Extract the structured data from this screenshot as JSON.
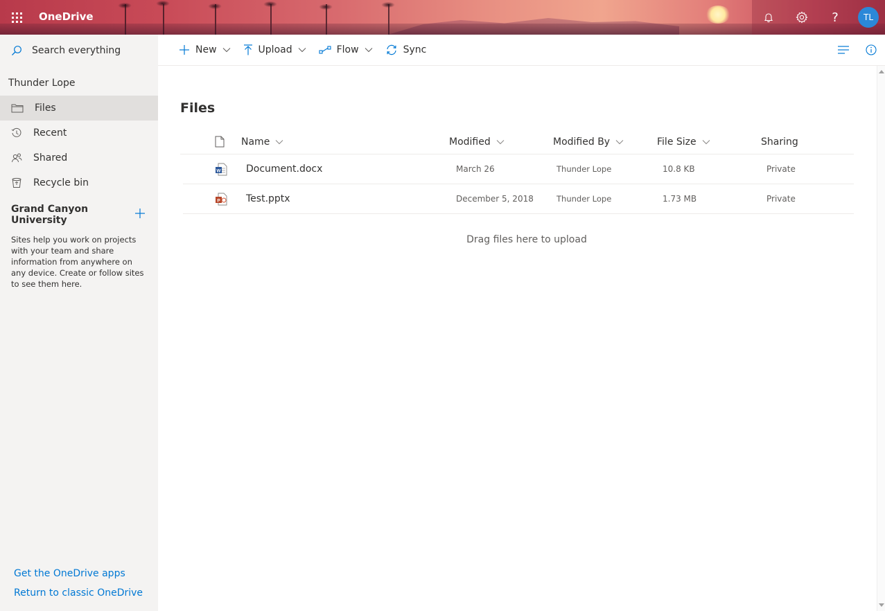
{
  "app": {
    "brand": "OneDrive",
    "user_initials": "TL"
  },
  "colors": {
    "accent": "#0078d4",
    "avatar": "#2b88d8",
    "nav_bg": "#f4f3f2",
    "selected_bg": "#e1dfdd",
    "word": "#2b579a",
    "powerpoint": "#b7472a"
  },
  "nav": {
    "search_placeholder": "Search everything",
    "owner": "Thunder Lope",
    "items": [
      {
        "label": "Files",
        "icon": "folder-icon",
        "selected": true
      },
      {
        "label": "Recent",
        "icon": "history-icon",
        "selected": false
      },
      {
        "label": "Shared",
        "icon": "people-icon",
        "selected": false
      },
      {
        "label": "Recycle bin",
        "icon": "recycle-bin-icon",
        "selected": false
      }
    ],
    "group_title": "Grand Canyon University",
    "group_help": "Sites help you work on projects with your team and share information from anywhere on any device. Create or follow sites to see them here.",
    "footer_links": [
      "Get the OneDrive apps",
      "Return to classic OneDrive"
    ]
  },
  "commands": {
    "new": "New",
    "upload": "Upload",
    "flow": "Flow",
    "sync": "Sync"
  },
  "main": {
    "title": "Files",
    "columns": {
      "name": "Name",
      "modified": "Modified",
      "modified_by": "Modified By",
      "file_size": "File Size",
      "sharing": "Sharing"
    },
    "rows": [
      {
        "name": "Document.docx",
        "type": "word",
        "modified": "March 26",
        "modified_by": "Thunder Lope",
        "size": "10.8 KB",
        "sharing": "Private"
      },
      {
        "name": "Test.pptx",
        "type": "powerpoint",
        "modified": "December 5, 2018",
        "modified_by": "Thunder Lope",
        "size": "1.73 MB",
        "sharing": "Private"
      }
    ],
    "drag_hint": "Drag files here to upload"
  }
}
